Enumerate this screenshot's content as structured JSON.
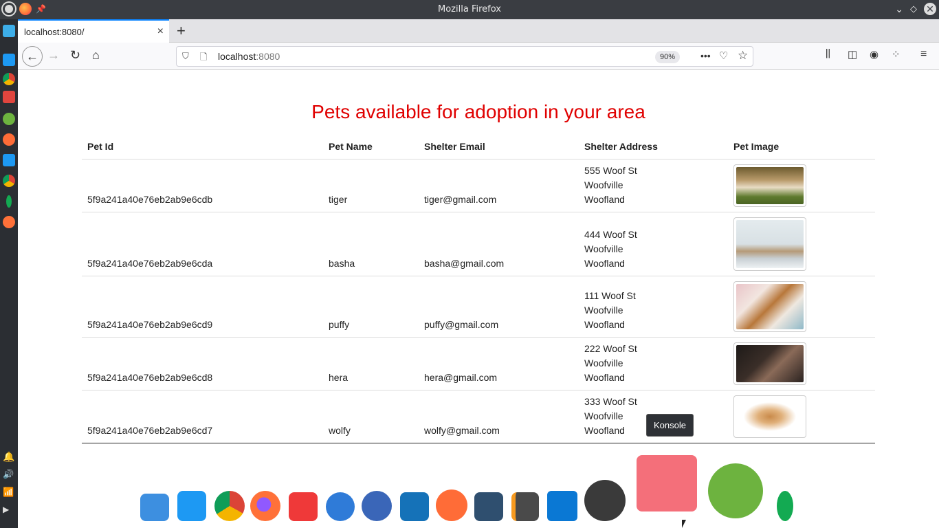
{
  "window": {
    "title": "Mozilla Firefox"
  },
  "tab": {
    "title": "localhost:8080/",
    "close": "×",
    "new": "+"
  },
  "url": {
    "host": "localhost",
    "port": ":8080",
    "zoom": "90%"
  },
  "page": {
    "heading": "Pets available for adoption in your area",
    "columns": [
      "Pet Id",
      "Pet Name",
      "Shelter Email",
      "Shelter Address",
      "Pet Image"
    ],
    "rows": [
      {
        "id": "5f9a241a40e76eb2ab9e6cdb",
        "name": "tiger",
        "email": "tiger@gmail.com",
        "addr1": "555 Woof St",
        "addr2": "Woofville",
        "addr3": "Woofland"
      },
      {
        "id": "5f9a241a40e76eb2ab9e6cda",
        "name": "basha",
        "email": "basha@gmail.com",
        "addr1": "444 Woof St",
        "addr2": "Woofville",
        "addr3": "Woofland"
      },
      {
        "id": "5f9a241a40e76eb2ab9e6cd9",
        "name": "puffy",
        "email": "puffy@gmail.com",
        "addr1": "111 Woof St",
        "addr2": "Woofville",
        "addr3": "Woofland"
      },
      {
        "id": "5f9a241a40e76eb2ab9e6cd8",
        "name": "hera",
        "email": "hera@gmail.com",
        "addr1": "222 Woof St",
        "addr2": "Woofville",
        "addr3": "Woofland"
      },
      {
        "id": "5f9a241a40e76eb2ab9e6cd7",
        "name": "wolfy",
        "email": "wolfy@gmail.com",
        "addr1": "333 Woof St",
        "addr2": "Woofville",
        "addr3": "Woofland"
      }
    ]
  },
  "tooltip": {
    "text": "Konsole"
  },
  "colors": {
    "heading": "#e00000",
    "accent": "#0a84ff"
  }
}
